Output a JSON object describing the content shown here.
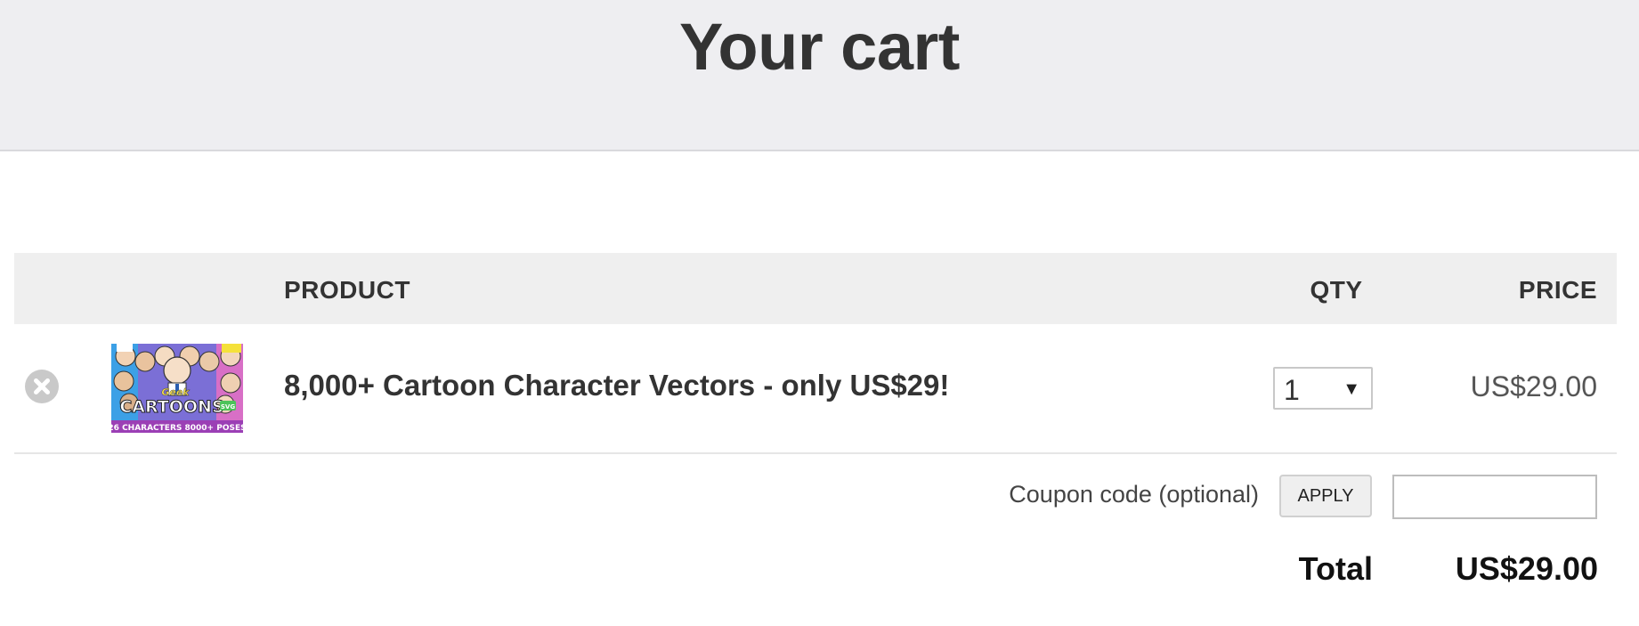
{
  "page": {
    "title": "Your cart"
  },
  "table": {
    "headers": {
      "product": "PRODUCT",
      "qty": "QTY",
      "price": "PRICE"
    }
  },
  "items": [
    {
      "name": "8,000+ Cartoon Character Vectors - only US$29!",
      "quantity": "1",
      "price": "US$29.00",
      "thumbnail": {
        "title": "CARTOONS",
        "script": "Geek",
        "caption": "26 CHARACTERS 8000+ POSES",
        "badge": "SVG"
      }
    }
  ],
  "coupon": {
    "label": "Coupon code (optional)",
    "apply_label": "APPLY",
    "value": ""
  },
  "summary": {
    "total_label": "Total",
    "total_value": "US$29.00"
  },
  "colors": {
    "header_bg": "#eeeef1",
    "table_head_bg": "#efefef",
    "text": "#333333",
    "remove_icon": "#c9c9c9"
  }
}
